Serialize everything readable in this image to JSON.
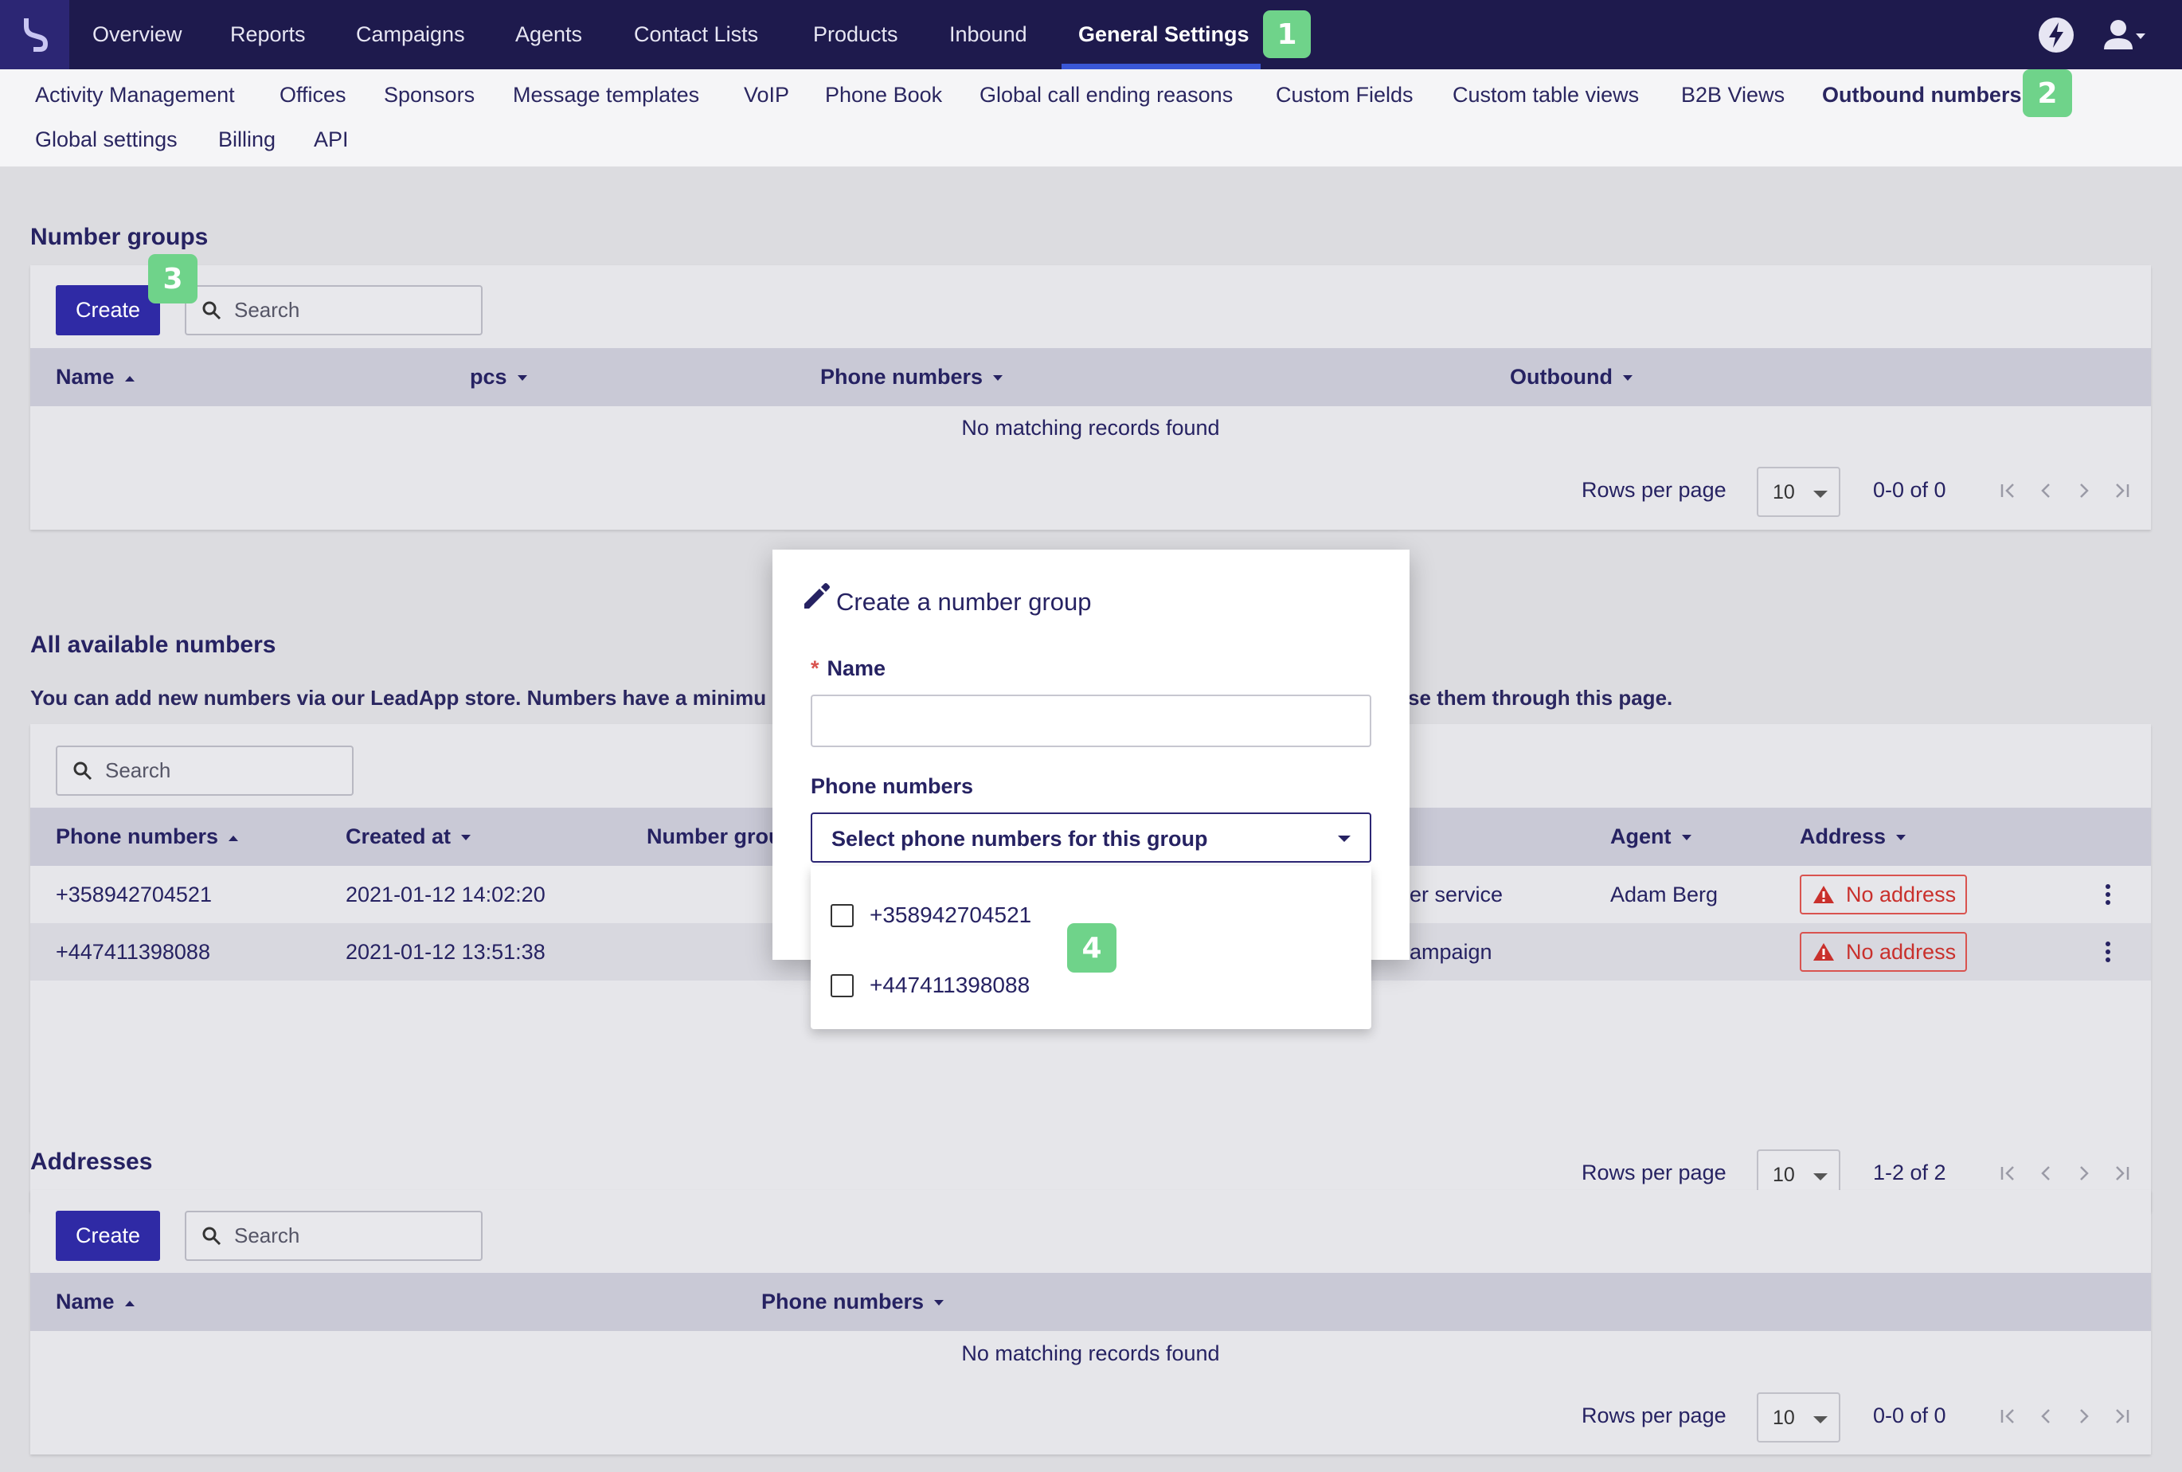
{
  "topnav": {
    "items": [
      "Overview",
      "Reports",
      "Campaigns",
      "Agents",
      "Contact Lists",
      "Products",
      "Inbound",
      "General Settings"
    ],
    "active": "General Settings"
  },
  "subnav": {
    "items": [
      "Activity Management",
      "Offices",
      "Sponsors",
      "Message templates",
      "VoIP",
      "Phone Book",
      "Global call ending reasons",
      "Custom Fields",
      "Custom table views",
      "B2B Views",
      "Outbound numbers",
      "Global settings",
      "Billing",
      "API"
    ],
    "active": "Outbound numbers"
  },
  "callouts": [
    "1",
    "2",
    "3",
    "4"
  ],
  "number_groups": {
    "title": "Number groups",
    "create_label": "Create",
    "search_placeholder": "Search",
    "columns": [
      "Name",
      "pcs",
      "Phone numbers",
      "Outbound"
    ],
    "empty_text": "No matching records found",
    "rows_per_page_label": "Rows per page",
    "rows_per_page_value": "10",
    "range_text": "0-0 of 0"
  },
  "available_numbers": {
    "title": "All available numbers",
    "description_left": "You can add new numbers via our LeadApp store. Numbers have a minimu",
    "description_right": "se them through this page.",
    "search_placeholder": "Search",
    "columns": [
      "Phone numbers",
      "Created at",
      "Number grou",
      "Agent",
      "Address"
    ],
    "rows": [
      {
        "phone": "+358942704521",
        "created": "2021-01-12 14:02:20",
        "campaign_fragment": "er service",
        "agent": "Adam Berg",
        "address": "No address"
      },
      {
        "phone": "+447411398088",
        "created": "2021-01-12 13:51:38",
        "campaign_fragment": "ampaign",
        "agent": "",
        "address": "No address"
      }
    ],
    "rows_per_page_label": "Rows per page",
    "rows_per_page_value": "10",
    "range_text": "1-2 of 2"
  },
  "addresses": {
    "title": "Addresses",
    "create_label": "Create",
    "search_placeholder": "Search",
    "columns": [
      "Name",
      "Phone numbers"
    ],
    "empty_text": "No matching records found",
    "rows_per_page_label": "Rows per page",
    "rows_per_page_value": "10",
    "range_text": "0-0 of 0"
  },
  "dialog": {
    "title": "Create a number group",
    "name_label": "Name",
    "name_required_mark": "*",
    "name_value": "",
    "phone_label": "Phone numbers",
    "select_placeholder": "Select phone numbers for this group",
    "options": [
      "+358942704521",
      "+447411398088"
    ]
  },
  "colors": {
    "topnav_bg": "#1e1a4d",
    "primary_button": "#2f2aa5",
    "callout": "#6fd38a",
    "error": "#d9534f"
  }
}
